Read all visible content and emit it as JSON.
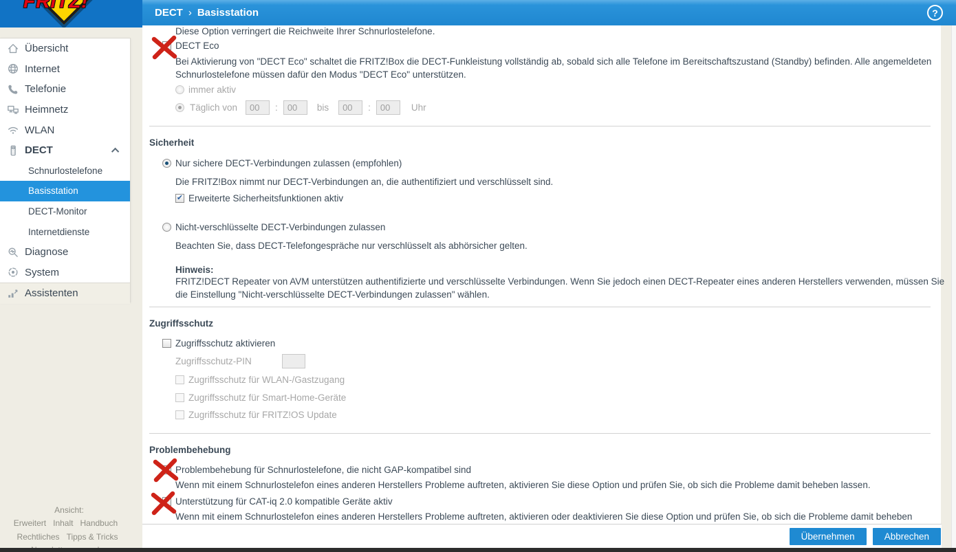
{
  "logo": {
    "brand": "FRITZ!"
  },
  "header": {
    "breadcrumb": {
      "section": "DECT",
      "separator": "›",
      "page": "Basisstation"
    },
    "help": "?"
  },
  "sidebar": {
    "items": [
      {
        "label": "Übersicht"
      },
      {
        "label": "Internet"
      },
      {
        "label": "Telefonie"
      },
      {
        "label": "Heimnetz"
      },
      {
        "label": "WLAN"
      },
      {
        "label": "DECT"
      }
    ],
    "dect_subitems": [
      {
        "label": "Schnurlostelefone"
      },
      {
        "label": "Basisstation",
        "selected": true
      },
      {
        "label": "DECT-Monitor"
      },
      {
        "label": "Internetdienste"
      }
    ],
    "items_after": [
      {
        "label": "Diagnose"
      },
      {
        "label": "System"
      },
      {
        "label": "Assistenten"
      }
    ],
    "footer_links": {
      "view": "Ansicht: Erweitert",
      "content": "Inhalt",
      "manual": "Handbuch",
      "legal": "Rechtliches",
      "tips": "Tipps & Tricks",
      "newsletter": "Newsletter",
      "site": "avm.de"
    }
  },
  "main": {
    "dect_eco": {
      "intro": "Diese Option verringert die Reichweite Ihrer Schnurlostelefone.",
      "checkbox_label": "DECT Eco",
      "description": "Bei Aktivierung von \"DECT Eco\" schaltet die FRITZ!Box die DECT-Funkleistung vollständig ab, sobald sich alle Telefone im Bereitschaftszustand (Standby) befinden. Alle angemeldeten Schnurlostelefone müssen dafür den Modus \"DECT Eco\" unterstützen.",
      "radio_always": "immer aktiv",
      "radio_daily": "Täglich von",
      "time_sep": ":",
      "between_label": "bis",
      "suffix_label": "Uhr",
      "time_values": [
        "00",
        "00",
        "00",
        "00"
      ]
    },
    "sicherheit": {
      "title": "Sicherheit",
      "radio_secure": "Nur sichere DECT-Verbindungen zulassen (empfohlen)",
      "secure_note": "Die FRITZ!Box nimmt nur DECT-Verbindungen an, die authentifiziert und verschlüsselt sind.",
      "checkbox_extended": "Erweiterte Sicherheitsfunktionen aktiv",
      "radio_unencrypted": "Nicht-verschlüsselte DECT-Verbindungen zulassen",
      "unencrypted_note": "Beachten Sie, dass DECT-Telefongespräche nur verschlüsselt als abhörsicher gelten.",
      "hint_title": "Hinweis:",
      "hint_text": "FRITZ!DECT Repeater von AVM unterstützen authentifizierte und verschlüsselte Verbindungen. Wenn Sie jedoch einen DECT-Repeater eines anderen Herstellers verwenden, müssen Sie die Einstellung \"Nicht-verschlüsselte DECT-Verbindungen zulassen\" wählen."
    },
    "zugriffsschutz": {
      "title": "Zugriffsschutz",
      "checkbox_activate": "Zugriffsschutz aktivieren",
      "pin_label": "Zugriffsschutz-PIN",
      "pin_value": "",
      "checkbox_wlan": "Zugriffsschutz für WLAN-/Gastzugang",
      "checkbox_smarthome": "Zugriffsschutz für Smart-Home-Geräte",
      "checkbox_fritzos": "Zugriffsschutz für FRITZ!OS Update"
    },
    "problembehebung": {
      "title": "Problembehebung",
      "checkbox_gap": "Problembehebung für Schnurlostelefone, die nicht GAP-kompatibel sind",
      "gap_note": "Wenn mit einem Schnurlostelefon eines anderen Herstellers Probleme auftreten, aktivieren Sie diese Option und prüfen Sie, ob sich die Probleme damit beheben lassen.",
      "checkbox_catiq": "Unterstützung für CAT-iq 2.0 kompatible Geräte aktiv",
      "catiq_note": "Wenn mit einem Schnurlostelefon eines anderen Herstellers Probleme auftreten, aktivieren oder deaktivieren Sie diese Option und prüfen Sie, ob sich die Probleme damit beheben lassen."
    }
  },
  "footer": {
    "apply_label": "Übernehmen",
    "cancel_label": "Abbrechen"
  },
  "annotations": {
    "crossed_out": [
      "DECT Eco",
      "Problembehebung für Schnurlostelefone, die nicht GAP-kompatibel sind",
      "Unterstützung für CAT-iq 2.0 kompatible Geräte aktiv"
    ],
    "color": "#ce2318"
  },
  "colors": {
    "accent_blue": "#1f87d0",
    "selected_blue": "#2393dd",
    "page_background": "#efede4",
    "annotation_red": "#ce2318"
  }
}
